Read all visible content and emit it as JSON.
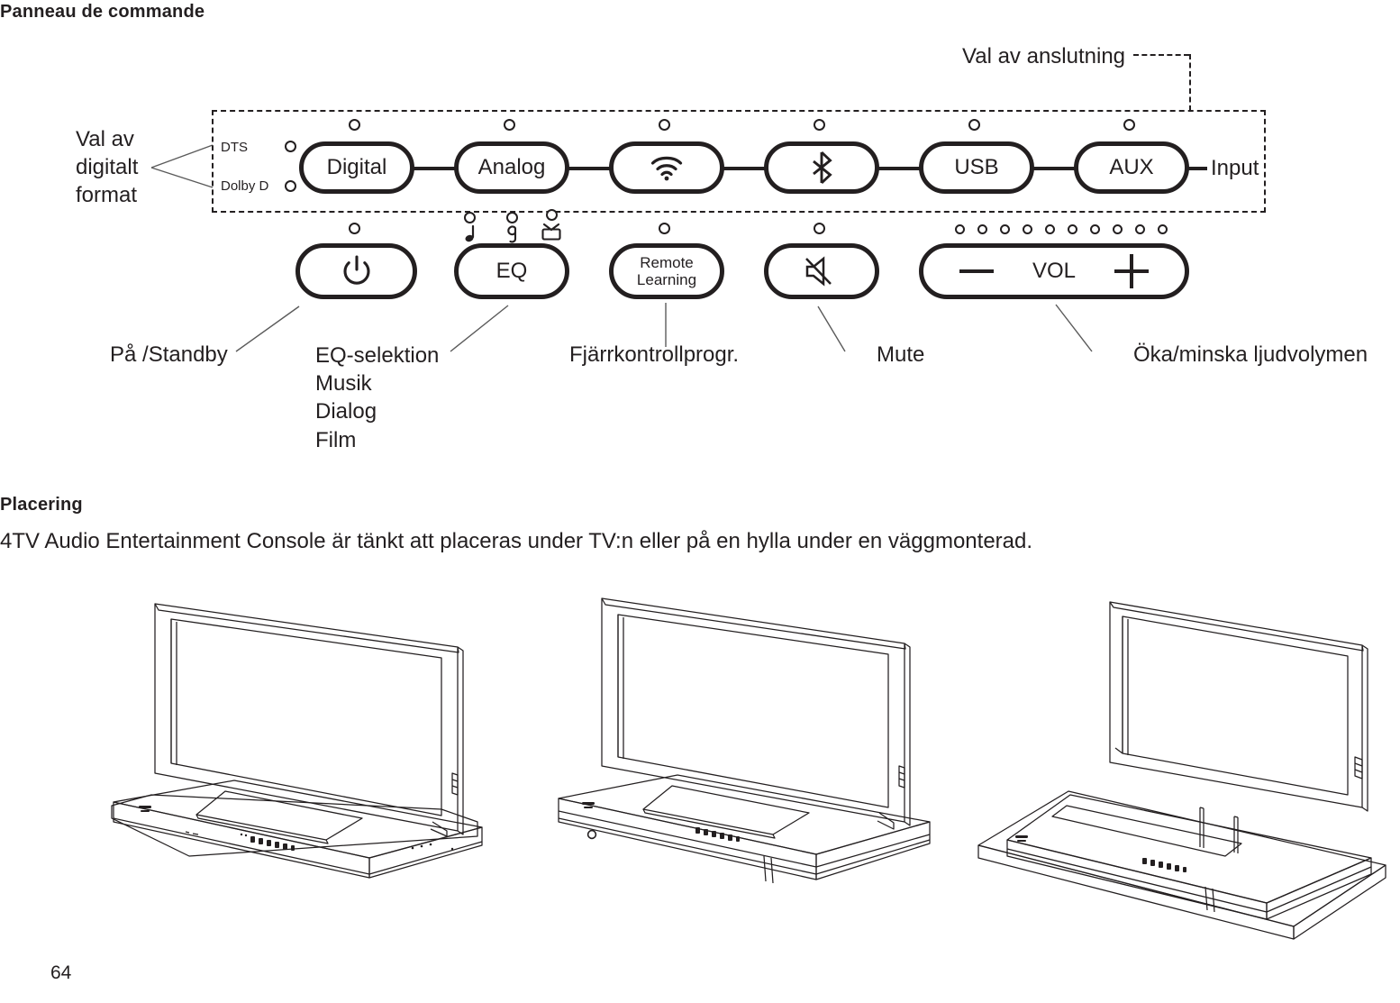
{
  "page": {
    "heading": "Panneau de commande",
    "number": "64"
  },
  "control_panel": {
    "callouts": {
      "digital_format": "Val av\ndigitalt\nformat",
      "digital_format_lines": [
        "Val av",
        "digitalt",
        "format"
      ],
      "connection_select": "Val av anslutning",
      "input_label": "Input",
      "power": "På /Standby",
      "eq": "EQ-selektion",
      "eq_modes": [
        "Musik",
        "Dialog",
        "Film"
      ],
      "remote": "Fjärrkontrollprogr.",
      "mute": "Mute",
      "volume": "Öka/minska ljudvolymen"
    },
    "format_indicators": [
      {
        "label": "DTS",
        "icon": "led-indicator-icon"
      },
      {
        "label": "Dolby D",
        "icon": "led-indicator-icon"
      }
    ],
    "source_buttons": [
      {
        "label": "Digital",
        "icon": null
      },
      {
        "label": "Analog",
        "icon": null
      },
      {
        "label": "",
        "icon": "wifi-icon"
      },
      {
        "label": "",
        "icon": "bluetooth-icon"
      },
      {
        "label": "USB",
        "icon": null
      },
      {
        "label": "AUX",
        "icon": null
      }
    ],
    "function_buttons": [
      {
        "label": "",
        "icon": "power-icon"
      },
      {
        "label": "EQ",
        "icon": null
      },
      {
        "label": "Remote\nLearning",
        "label_line1": "Remote",
        "label_line2": "Learning",
        "icon": null
      },
      {
        "label": "",
        "icon": "mute-icon"
      }
    ],
    "eq_mode_icons": [
      {
        "name": "music-note-icon",
        "mode": "Musik"
      },
      {
        "name": "dialog-icon",
        "mode": "Dialog"
      },
      {
        "name": "film-tv-icon",
        "mode": "Film"
      }
    ],
    "volume_control": {
      "minus_label": "−",
      "center_label": "VOL",
      "plus_label": "+",
      "led_count": 10
    }
  },
  "placement": {
    "heading": "Placering",
    "text": "4TV Audio Entertainment Console är tänkt att placeras under TV:n eller på en hylla under en väggmonterad.",
    "illustrations": [
      {
        "name": "tv-on-console-front-view",
        "caption": ""
      },
      {
        "name": "tv-on-console-angled-view",
        "caption": ""
      },
      {
        "name": "wall-mounted-tv-console-on-shelf",
        "caption": ""
      }
    ]
  },
  "colors": {
    "ink": "#231f20",
    "paper": "#ffffff",
    "leader": "#5a5a5a"
  }
}
